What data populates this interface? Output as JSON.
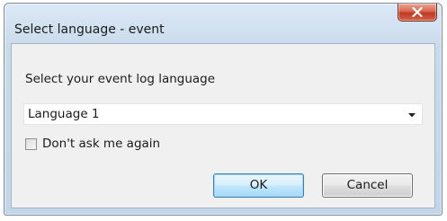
{
  "window": {
    "title": "Select language - event"
  },
  "dialog": {
    "prompt": "Select your event log language",
    "language_select": {
      "selected": "Language 1"
    },
    "dont_ask": {
      "label": "Don't ask me again",
      "checked": false
    },
    "ok_label": "OK",
    "cancel_label": "Cancel"
  },
  "icons": {
    "close": "close-icon",
    "dropdown": "chevron-down-icon"
  },
  "colors": {
    "close_button": "#c0391f",
    "default_button_border": "#3c7fb1",
    "content_background": "#f0f0f0",
    "frame": "#c9daea"
  }
}
